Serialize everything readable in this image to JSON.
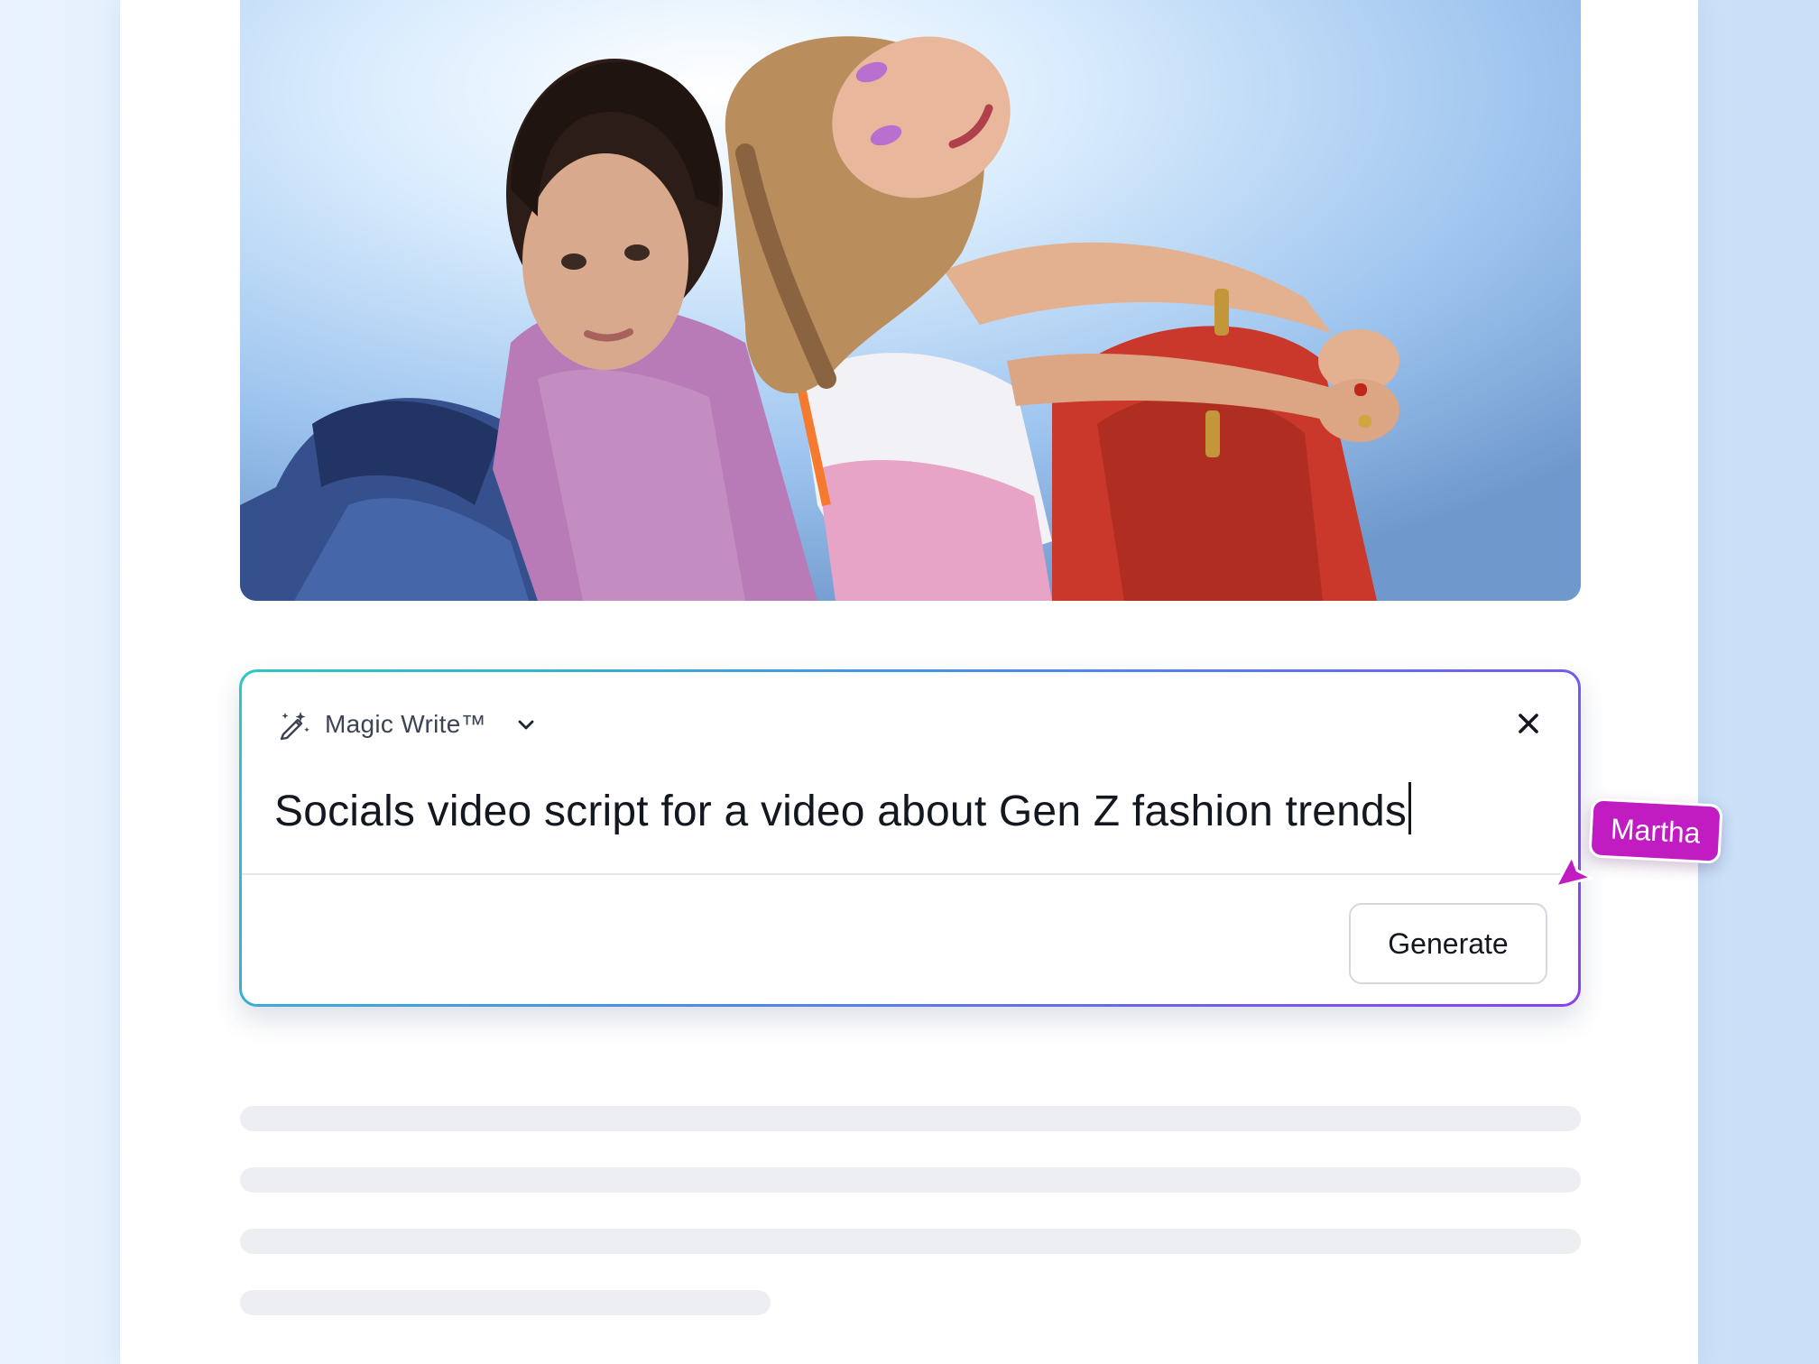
{
  "magic_write": {
    "title": "Magic Write™",
    "prompt_text": "Socials video script for a video about Gen Z fashion trends",
    "generate_label": "Generate"
  },
  "collaborator": {
    "name": "Martha",
    "color": "#c11cc2"
  },
  "colors": {
    "panel_border_start": "#2ec7c2",
    "panel_border_end": "#8a3ff0",
    "background": "#d6e8fb"
  },
  "icons": {
    "wand": "magic-wand-icon",
    "chevron": "chevron-down-icon",
    "close": "close-icon",
    "cursor": "cursor-arrow-icon"
  },
  "photo": {
    "subject": "two people sitting back to back in colorful outfits on a blue backdrop"
  }
}
